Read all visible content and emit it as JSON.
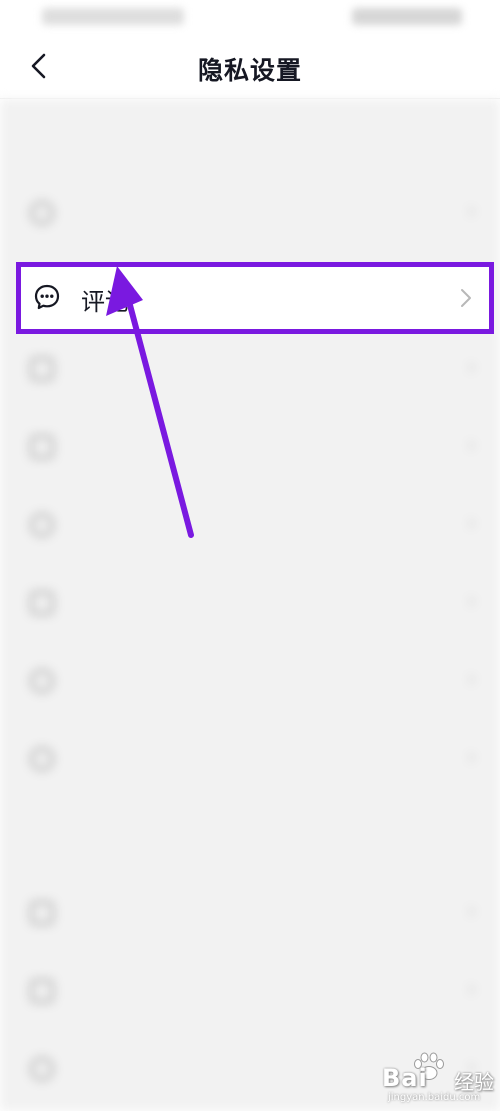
{
  "header": {
    "title": "隐私设置",
    "back_icon": "chevron-left-icon"
  },
  "highlighted_item": {
    "label": "评论",
    "icon": "comment-bubble-icon",
    "chevron_icon": "chevron-right-icon",
    "highlight_color": "#7a19e0"
  },
  "annotation": {
    "arrow_color": "#7a19e0"
  },
  "watermark": {
    "brand": "Bai",
    "suffix": "经验",
    "url": "jingyan.baidu.com"
  },
  "colors": {
    "background_dimmed": "#f2f2f2",
    "title_text": "#161823"
  }
}
